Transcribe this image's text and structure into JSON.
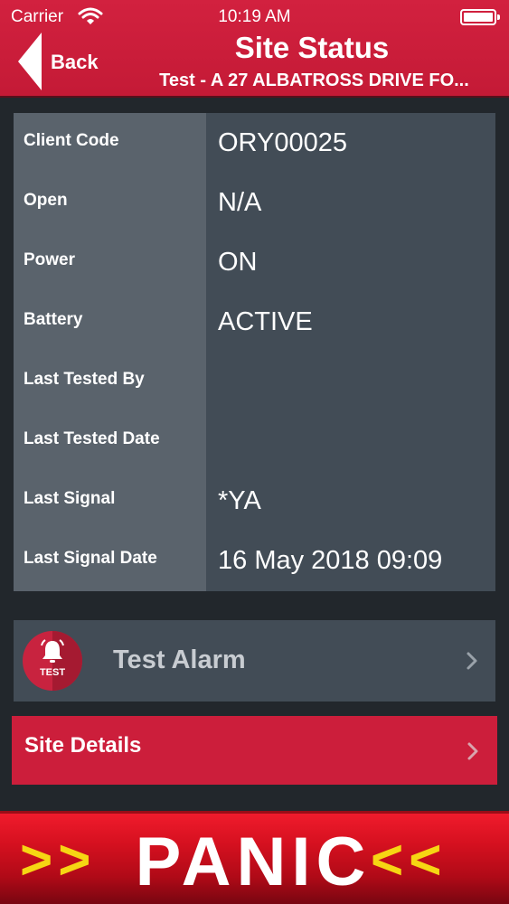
{
  "status_bar": {
    "carrier": "Carrier",
    "time": "10:19 AM"
  },
  "header": {
    "back_label": "Back",
    "title": "Site Status",
    "subtitle": "Test - A 27 ALBATROSS DRIVE FO..."
  },
  "info": {
    "rows": [
      {
        "label": "Client Code",
        "value": "ORY00025"
      },
      {
        "label": "Open",
        "value": "N/A"
      },
      {
        "label": "Power",
        "value": "ON"
      },
      {
        "label": "Battery",
        "value": "ACTIVE"
      },
      {
        "label": "Last Tested By",
        "value": ""
      },
      {
        "label": "Last Tested Date",
        "value": ""
      },
      {
        "label": "Last Signal",
        "value": "*YA"
      },
      {
        "label": "Last Signal Date",
        "value": "16 May 2018 09:09"
      }
    ]
  },
  "test_alarm": {
    "icon_text": "TEST",
    "label": "Test Alarm"
  },
  "site_details": {
    "label": "Site Details"
  },
  "panic": {
    "left_arrows": ">>",
    "label": "PANIC",
    "right_arrows": "<<"
  },
  "colors": {
    "brand_red": "#c41a36",
    "panel_dark": "#424c56",
    "panel_label": "#5a636c",
    "panic_yellow": "#f6d613"
  },
  "icons": {
    "wifi": "wifi-icon",
    "battery": "battery-icon",
    "back": "chevron-left-icon",
    "alarm": "bell-icon",
    "disclosure": "chevron-right-icon"
  }
}
